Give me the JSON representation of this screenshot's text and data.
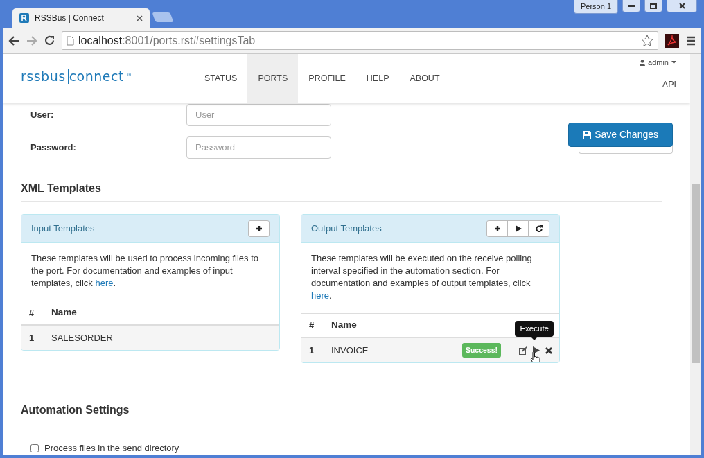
{
  "browser": {
    "tab_title": "RSSBus | Connect",
    "profile": "Person 1",
    "address_host": "localhost",
    "address_rest": ":8001/ports.rst#settingsTab"
  },
  "navbar": {
    "logo_left": "rssbus",
    "logo_right": "connect",
    "logo_mark": "™",
    "items": [
      {
        "label": "STATUS",
        "selected": false
      },
      {
        "label": "PORTS",
        "selected": true
      },
      {
        "label": "PROFILE",
        "selected": false
      },
      {
        "label": "HELP",
        "selected": false
      },
      {
        "label": "ABOUT",
        "selected": false
      }
    ],
    "user_menu": "admin",
    "api_link": "API"
  },
  "form_fields": [
    {
      "label": "User:",
      "placeholder": "User"
    },
    {
      "label": "Password:",
      "placeholder": "Password"
    }
  ],
  "save_button": "Save Changes",
  "xml_templates": {
    "title": "XML Templates",
    "panels": [
      {
        "title": "Input Templates",
        "tools": [
          {
            "kind": "add"
          }
        ],
        "description": "These templates will be used to process incoming files to the port. For documentation and examples of input templates, click ",
        "link": "here",
        "description_end": ".",
        "columns": [
          "#",
          "Name"
        ],
        "rows": [
          {
            "number": "1",
            "name": "SALESORDER"
          }
        ]
      },
      {
        "title": "Output Templates",
        "tools": [
          {
            "kind": "add"
          },
          {
            "kind": "execute"
          },
          {
            "kind": "refresh"
          }
        ],
        "description": "These templates will be executed on the receive polling interval specified in the automation section. For documentation and examples of output templates, click ",
        "link": "here",
        "description_end": ".",
        "columns": [
          "#",
          "Name"
        ],
        "rows": [
          {
            "number": "1",
            "name": "INVOICE",
            "status": "Success!",
            "tooltip": "Execute"
          }
        ]
      }
    ]
  },
  "automation": {
    "title": "Automation Settings",
    "checkbox": {
      "label": "Process files in the send directory",
      "checked": false
    }
  }
}
